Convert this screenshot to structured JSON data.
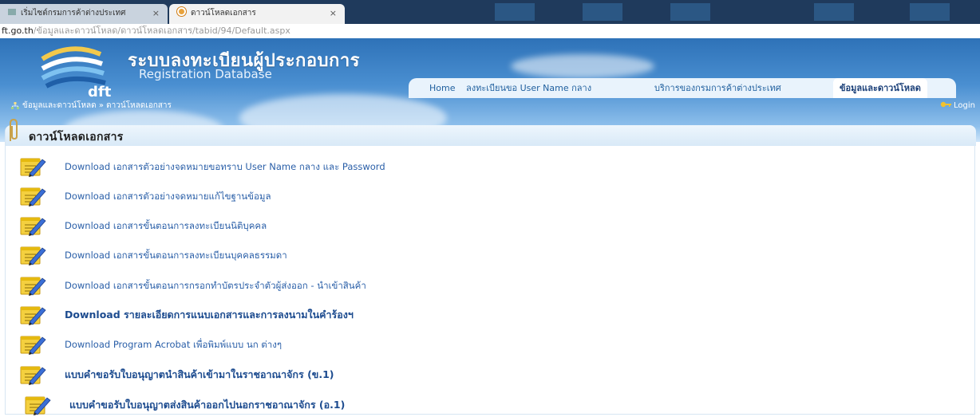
{
  "browser": {
    "tabs": [
      {
        "title": "เริ่มไซต์กรมการค้าต่างประเทศ",
        "active": false
      },
      {
        "title": "ดาวน์โหลดเอกสาร",
        "active": true
      }
    ],
    "url_host": "ft.go.th",
    "url_path": "/ข้อมูลและดาวน์โหลด/ดาวน์โหลดเอกสาร/tabid/94/Default.aspx"
  },
  "header": {
    "logo_text": "dft",
    "site_title": "ระบบลงทะเบียนผู้ประกอบการ",
    "site_subtitle": "Registration Database"
  },
  "nav": {
    "items": [
      {
        "label": "Home",
        "active": false
      },
      {
        "label": "ลงทะเบียนขอ User Name กลาง",
        "active": false
      },
      {
        "label": "บริการของกรมการค้าต่างประเทศ",
        "active": false
      },
      {
        "label": "ข้อมูลและดาวน์โหลด",
        "active": true
      }
    ]
  },
  "breadcrumb": "ข้อมูลและดาวน์โหลด » ดาวน์โหลดเอกสาร",
  "login_label": "Login",
  "panel": {
    "title": "ดาวน์โหลดเอกสาร",
    "documents": [
      {
        "label": "Download เอกสารตัวอย่างจดหมายขอทราบ User Name กลาง และ Password",
        "bold": false
      },
      {
        "label": "Download เอกสารตัวอย่างจดหมายแก้ไขฐานข้อมูล",
        "bold": false
      },
      {
        "label": "Download เอกสารขั้นตอนการลงทะเบียนนิติบุคคล",
        "bold": false
      },
      {
        "label": "Download เอกสารขั้นตอนการลงทะเบียนบุคคลธรรมดา",
        "bold": false
      },
      {
        "label": "Download เอกสารขั้นตอนการกรอกทำบัตรประจำตัวผู้ส่งออก - นำเข้าสินค้า",
        "bold": false
      },
      {
        "label": "Download รายละเอียดการแนบเอกสารและการลงนามในคำร้องฯ",
        "bold": true
      },
      {
        "label": "Download Program Acrobat เพื่อพิมพ์แบบ นก ต่างๆ",
        "bold": false
      },
      {
        "label": "แบบคำขอรับใบอนุญาตนำสินค้าเข้ามาในราชอาณาจักร (ข.1)",
        "bold": true
      },
      {
        "label": "แบบคำขอรับใบอนุญาตส่งสินค้าออกไปนอกราชอาณาจักร (อ.1)",
        "bold": true
      }
    ]
  },
  "colors": {
    "header_blue": "#2e72b8",
    "link_blue": "#2a5fa8",
    "nav_text": "#1f5f9e"
  }
}
